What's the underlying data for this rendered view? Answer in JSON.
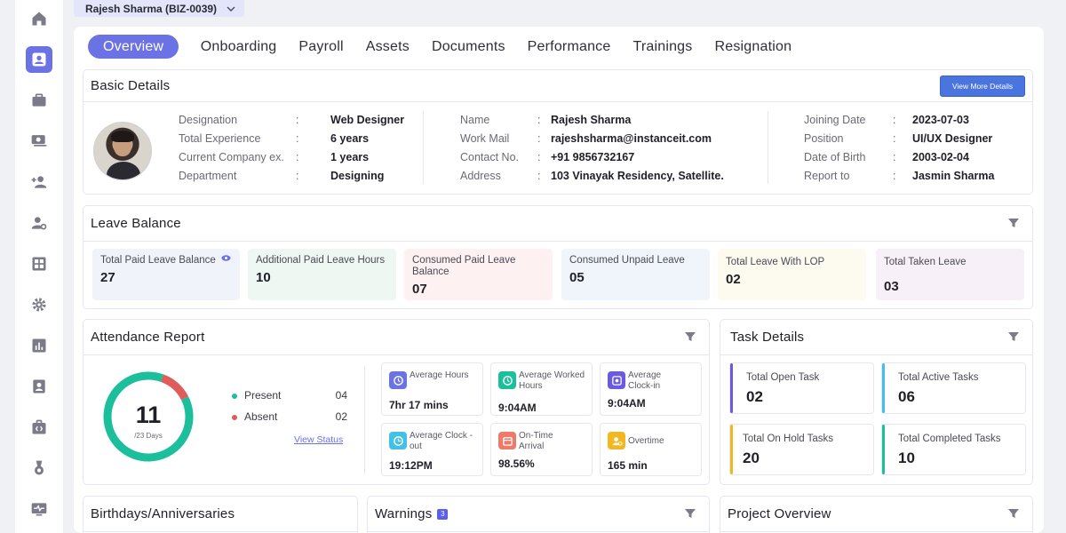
{
  "employee_selector": {
    "label": "Rajesh Sharma (BIZ-0039)"
  },
  "tabs": [
    {
      "label": "Overview"
    },
    {
      "label": "Onboarding"
    },
    {
      "label": "Payroll"
    },
    {
      "label": "Assets"
    },
    {
      "label": "Documents"
    },
    {
      "label": "Performance"
    },
    {
      "label": "Trainings"
    },
    {
      "label": "Resignation"
    }
  ],
  "basic_details": {
    "title": "Basic Details",
    "view_more": "View More Details",
    "col1": [
      {
        "label": "Designation",
        "value": "Web Designer"
      },
      {
        "label": "Total Experience",
        "value": "6 years"
      },
      {
        "label": "Current Company ex.",
        "value": "1 years"
      },
      {
        "label": "Department",
        "value": "Designing"
      }
    ],
    "col2": [
      {
        "label": "Name",
        "value": "Rajesh Sharma"
      },
      {
        "label": "Work Mail",
        "value": "rajeshsharma@instanceit.com"
      },
      {
        "label": "Contact No.",
        "value": "+91 9856732167"
      },
      {
        "label": "Address",
        "value": "103 Vinayak Residency, Satellite."
      }
    ],
    "col3": [
      {
        "label": "Joining Date",
        "value": "2023-07-03"
      },
      {
        "label": "Position",
        "value": "UI/UX Designer"
      },
      {
        "label": "Date of Birth",
        "value": "2003-02-04"
      },
      {
        "label": "Report to",
        "value": "Jasmin Sharma"
      }
    ]
  },
  "leave_balance": {
    "title": "Leave Balance",
    "items": [
      {
        "label": "Total Paid Leave Balance",
        "value": "27",
        "bg": "#f1f3fb"
      },
      {
        "label": "Additional Paid Leave Hours",
        "value": "10",
        "bg": "#eef7f2"
      },
      {
        "label": "Consumed Paid Leave Balance",
        "value": "07",
        "bg": "#fdf1f1"
      },
      {
        "label": "Consumed Unpaid Leave",
        "value": "05",
        "bg": "#eff5fb"
      },
      {
        "label": "Total Leave With LOP",
        "value": "02",
        "bg": "#fdfaef"
      },
      {
        "label": "Total Taken Leave",
        "value": "03",
        "bg": "#f8f0f8"
      }
    ]
  },
  "attendance": {
    "title": "Attendance Report",
    "present_days": 11,
    "total_days_label": "/23 Days",
    "present_color": "#1cbf9c",
    "absent_color": "#e05b5b",
    "legend": [
      {
        "label": "Present",
        "value": "04",
        "color": "#1cbf9c"
      },
      {
        "label": "Absent",
        "value": "02",
        "color": "#e05b5b"
      }
    ],
    "present_fraction": 0.88,
    "view_status": "View Status",
    "boxes": [
      {
        "label": "Average Hours",
        "value": "7hr 17 mins",
        "icon": "clock-rotate-icon",
        "color": "#6a72e4"
      },
      {
        "label": "Average Worked Hours",
        "value": "9:04AM",
        "icon": "clock-icon",
        "color": "#1cbf9c"
      },
      {
        "label": "Average Clock-in",
        "value": "9:04AM",
        "icon": "clock-in-icon",
        "color": "#6a5ae0"
      },
      {
        "label": "Average Clock -out",
        "value": "19:12PM",
        "icon": "clock-out-icon",
        "color": "#42c0e8"
      },
      {
        "label": "On-Time Arrival",
        "value": "98.56%",
        "icon": "calendar-icon",
        "color": "#f07a6a"
      },
      {
        "label": "Overtime",
        "value": "165 min",
        "icon": "overtime-icon",
        "color": "#f2b824"
      }
    ]
  },
  "task_details": {
    "title": "Task Details",
    "items": [
      {
        "label": "Total Open Task",
        "value": "02",
        "color": "#6a5ae0"
      },
      {
        "label": "Total Active Tasks",
        "value": "06",
        "color": "#42c0e8"
      },
      {
        "label": "Total On Hold Tasks",
        "value": "20",
        "color": "#f2b824"
      },
      {
        "label": "Total Completed Tasks",
        "value": "10",
        "color": "#1cbf9c"
      }
    ]
  },
  "birthdays": {
    "title": "Birthdays/Anniversaries"
  },
  "warnings": {
    "title": "Warnings",
    "count": "3"
  },
  "project_overview": {
    "title": "Project Overview"
  }
}
